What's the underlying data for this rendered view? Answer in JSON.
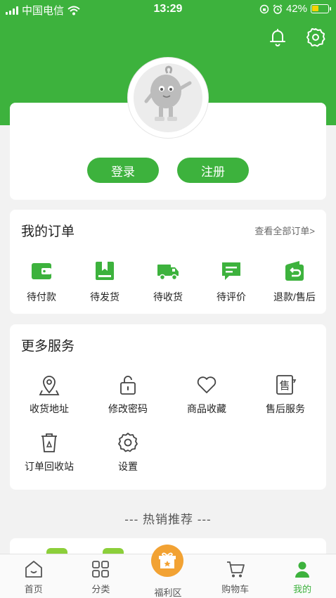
{
  "status_bar": {
    "carrier": "中国电信",
    "time": "13:29",
    "battery": "42%",
    "battery_level": 0.42
  },
  "profile": {
    "login_label": "登录",
    "register_label": "注册"
  },
  "orders": {
    "title": "我的订单",
    "view_all": "查看全部订单>",
    "items": [
      {
        "label": "待付款",
        "icon": "wallet-icon"
      },
      {
        "label": "待发货",
        "icon": "package-icon"
      },
      {
        "label": "待收货",
        "icon": "truck-icon"
      },
      {
        "label": "待评价",
        "icon": "comment-icon"
      },
      {
        "label": "退款/售后",
        "icon": "refund-icon"
      }
    ]
  },
  "services": {
    "title": "更多服务",
    "items": [
      {
        "label": "收货地址",
        "icon": "location-icon"
      },
      {
        "label": "修改密码",
        "icon": "lock-icon"
      },
      {
        "label": "商品收藏",
        "icon": "heart-icon"
      },
      {
        "label": "售后服务",
        "icon": "after-sale-icon"
      },
      {
        "label": "订单回收站",
        "icon": "recycle-bin-icon"
      },
      {
        "label": "设置",
        "icon": "gear-icon"
      }
    ]
  },
  "recommend": {
    "title": "--- 热销推荐 ---"
  },
  "tabbar": {
    "items": [
      {
        "label": "首页",
        "icon": "home-icon"
      },
      {
        "label": "分类",
        "icon": "category-icon"
      },
      {
        "label": "福利区",
        "icon": "gift-icon"
      },
      {
        "label": "购物车",
        "icon": "cart-icon"
      },
      {
        "label": "我的",
        "icon": "user-icon"
      }
    ],
    "active_index": 4
  },
  "colors": {
    "brand": "#3db23d",
    "gift": "#f2a233"
  }
}
